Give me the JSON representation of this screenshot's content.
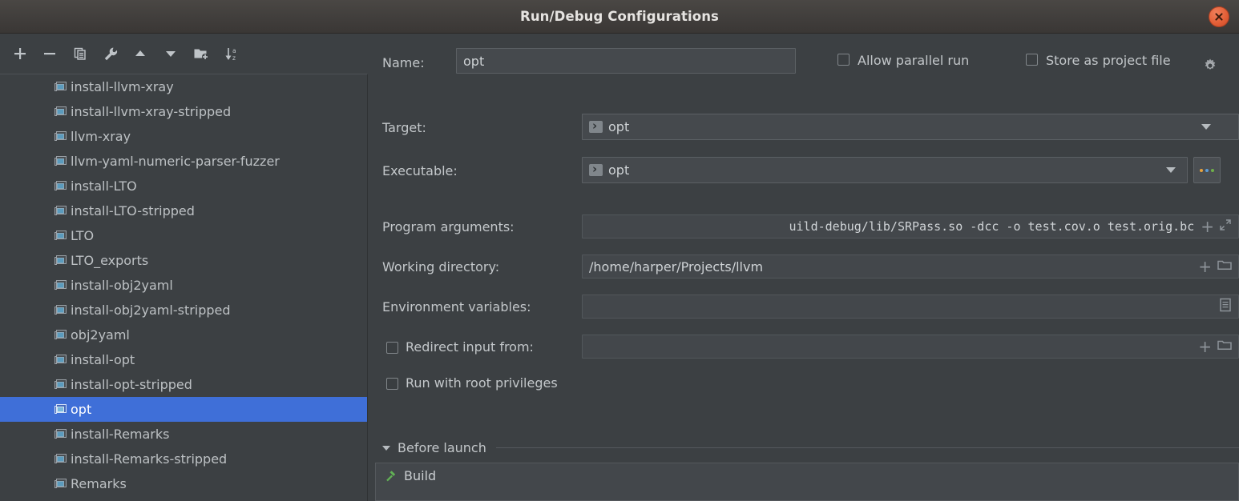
{
  "window": {
    "title": "Run/Debug Configurations",
    "close_label": "close-window"
  },
  "toolbar": {
    "buttons": [
      {
        "name": "add-configuration-button",
        "icon": "plus-icon",
        "label": "+"
      },
      {
        "name": "remove-configuration-button",
        "icon": "minus-icon",
        "label": "−"
      },
      {
        "name": "copy-configuration-button",
        "icon": "copy-icon",
        "label": "Copy Configuration"
      },
      {
        "name": "edit-templates-button",
        "icon": "wrench-icon",
        "label": "Edit Templates"
      },
      {
        "name": "move-up-button",
        "icon": "arrow-up-icon",
        "label": "Move Up"
      },
      {
        "name": "move-down-button",
        "icon": "arrow-down-icon",
        "label": "Move Down"
      },
      {
        "name": "new-folder-button",
        "icon": "folder-add-icon",
        "label": "New Folder"
      },
      {
        "name": "sort-configurations-button",
        "icon": "sort-alpha-icon",
        "label": "Sort Configurations"
      }
    ]
  },
  "sidebar": {
    "items": [
      {
        "label": "install-llvm-xray",
        "selected": false
      },
      {
        "label": "install-llvm-xray-stripped",
        "selected": false
      },
      {
        "label": "llvm-xray",
        "selected": false
      },
      {
        "label": "llvm-yaml-numeric-parser-fuzzer",
        "selected": false
      },
      {
        "label": "install-LTO",
        "selected": false
      },
      {
        "label": "install-LTO-stripped",
        "selected": false
      },
      {
        "label": "LTO",
        "selected": false
      },
      {
        "label": "LTO_exports",
        "selected": false
      },
      {
        "label": "install-obj2yaml",
        "selected": false
      },
      {
        "label": "install-obj2yaml-stripped",
        "selected": false
      },
      {
        "label": "obj2yaml",
        "selected": false
      },
      {
        "label": "install-opt",
        "selected": false
      },
      {
        "label": "install-opt-stripped",
        "selected": false
      },
      {
        "label": "opt",
        "selected": true
      },
      {
        "label": "install-Remarks",
        "selected": false
      },
      {
        "label": "install-Remarks-stripped",
        "selected": false
      },
      {
        "label": "Remarks",
        "selected": false
      }
    ]
  },
  "form": {
    "name_label": "Name:",
    "name_value": "opt",
    "allow_parallel_run_label": "Allow parallel run",
    "allow_parallel_run_checked": false,
    "store_as_project_file_label": "Store as project file",
    "store_as_project_file_checked": false,
    "target_label": "Target:",
    "target_value": "opt",
    "executable_label": "Executable:",
    "executable_value": "opt",
    "executable_browse_label": "...",
    "program_arguments_label": "Program arguments:",
    "program_arguments_value": "uild-debug/lib/SRPass.so -dcc -o test.cov.o test.orig.bc",
    "working_directory_label": "Working directory:",
    "working_directory_value": "/home/harper/Projects/llvm",
    "environment_variables_label": "Environment variables:",
    "environment_variables_value": "",
    "redirect_input_label": "Redirect input from:",
    "redirect_input_checked": false,
    "redirect_input_value": "",
    "run_root_label": "Run with root privileges",
    "run_root_checked": false
  },
  "before_launch": {
    "title": "Before launch",
    "expanded": true,
    "tasks": [
      {
        "label": "Build",
        "icon": "hammer-icon"
      }
    ]
  },
  "colors": {
    "dialog_bg": "#3c4043",
    "selection_blue": "#3f6fd8",
    "titlebar_top": "#4a4744",
    "close_button": "#e25d35",
    "hammer_green": "#62b255",
    "field_bg": "#45494d"
  }
}
